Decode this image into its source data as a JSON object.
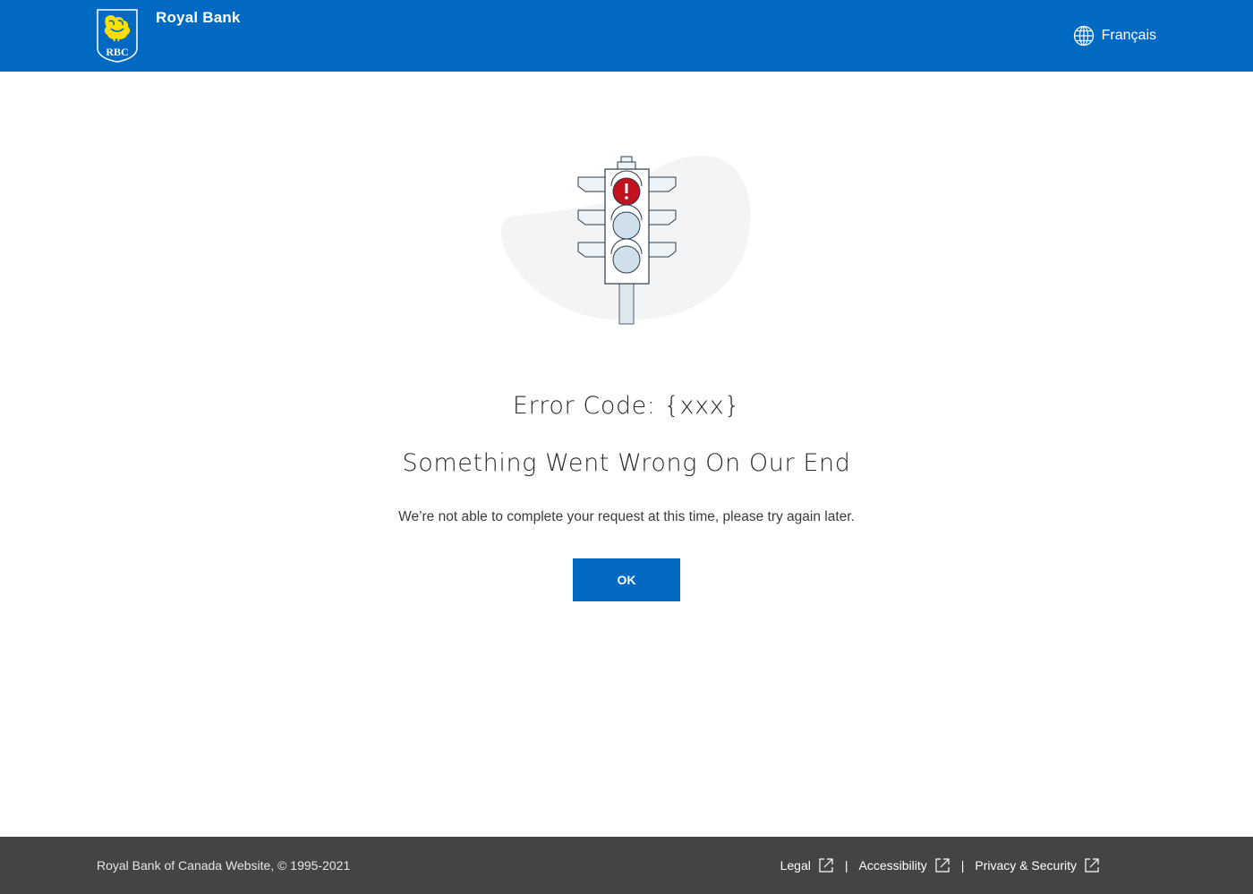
{
  "header": {
    "logo_text": "RBC",
    "brand_name": "Royal Bank",
    "language_link": "Français"
  },
  "main": {
    "error_code": "Error Code: {xxx}",
    "headline": "Something Went Wrong On Our End",
    "message": "We’re not able to complete your request at this time, please try again later.",
    "ok_button": "OK",
    "illustration_icon": "traffic-light-alert-icon"
  },
  "footer": {
    "copyright": "Royal Bank of Canada Website, © 1995-2021",
    "links": [
      {
        "label": "Legal",
        "icon": "external-link-icon"
      },
      {
        "label": "Accessibility",
        "icon": "external-link-icon"
      },
      {
        "label": "Privacy & Security",
        "icon": "external-link-icon"
      }
    ],
    "separator": "|"
  },
  "colors": {
    "brand_blue": "#006ac3",
    "logo_gold": "#fedf01",
    "alert_red": "#c1121f",
    "footer_bg": "#444444"
  }
}
